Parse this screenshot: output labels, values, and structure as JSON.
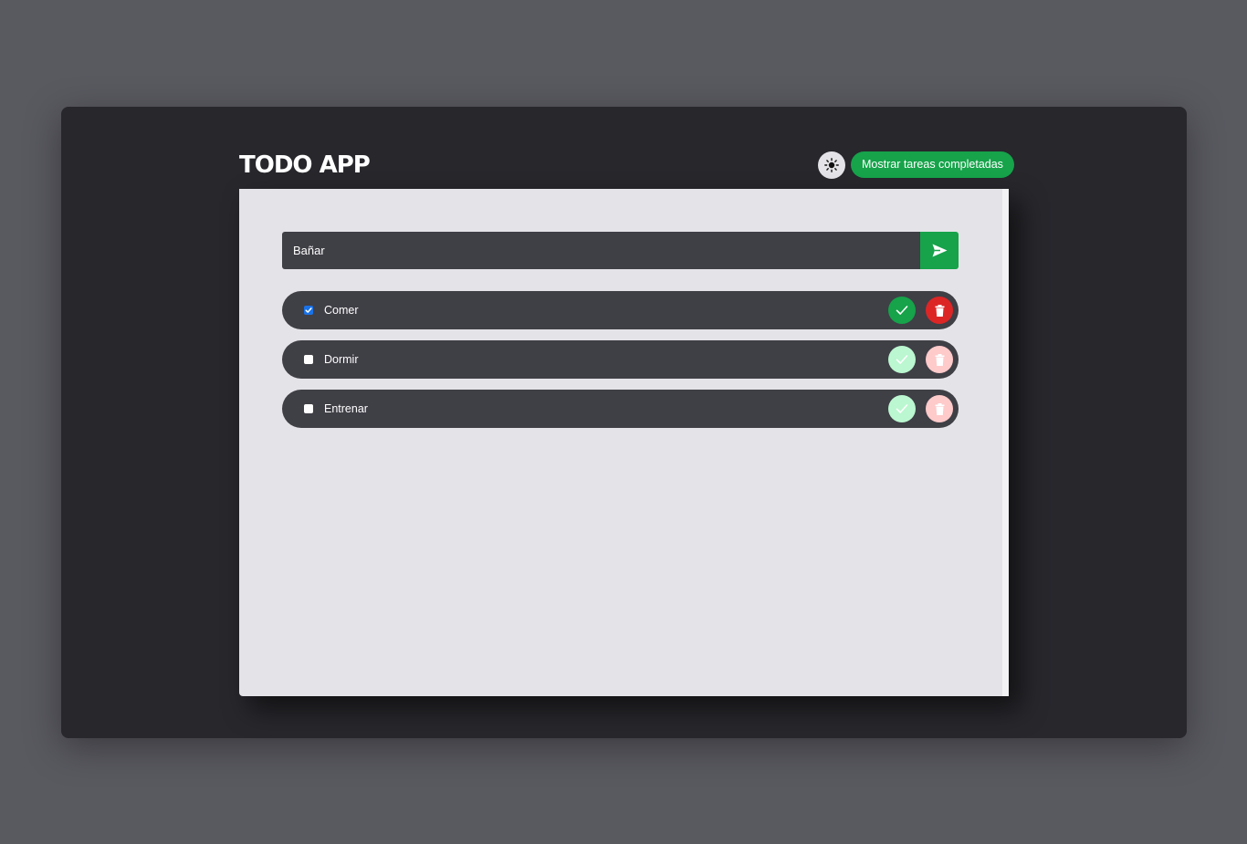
{
  "app": {
    "title": "TODO APP"
  },
  "header": {
    "theme_icon": "sun-icon",
    "show_completed_label": "Mostrar tareas completadas"
  },
  "input": {
    "value": "Bañar",
    "send_icon": "send-icon"
  },
  "tasks": [
    {
      "label": "Comer",
      "checked": true
    },
    {
      "label": "Dormir",
      "checked": false
    },
    {
      "label": "Entrenar",
      "checked": false
    }
  ],
  "colors": {
    "accent": "#16a34a",
    "danger": "#dc2626",
    "panel": "#e4e4e8",
    "item": "#3f3f46",
    "window": "#27272c",
    "background": "#595960"
  }
}
